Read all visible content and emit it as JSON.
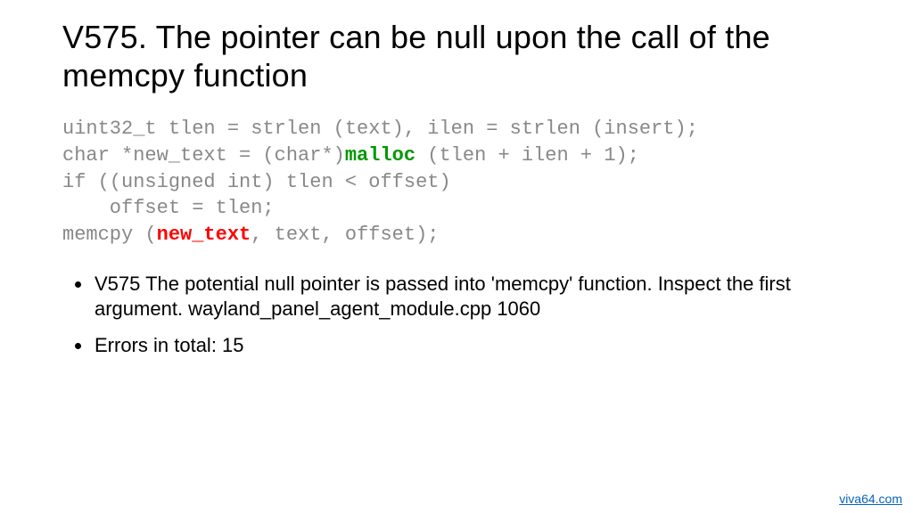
{
  "title": "V575. The pointer can be null upon the call of the memcpy function",
  "code": {
    "l1": "uint32_t tlen = strlen (text), ilen = strlen (insert);",
    "l2a": "char *new_text = (char*)",
    "l2b_green": "malloc",
    "l2c": " (tlen + ilen + 1);",
    "l3": "if ((unsigned int) tlen < offset)",
    "l4": "    offset = tlen;",
    "l5a": "memcpy (",
    "l5b_red": "new_text",
    "l5c": ", text, offset);"
  },
  "bullets": {
    "b1": "V575 The potential null pointer is passed into 'memcpy' function. Inspect the first argument. wayland_panel_agent_module.cpp 1060",
    "b2": "Errors in total: 15"
  },
  "footer_link": "viva64.com"
}
